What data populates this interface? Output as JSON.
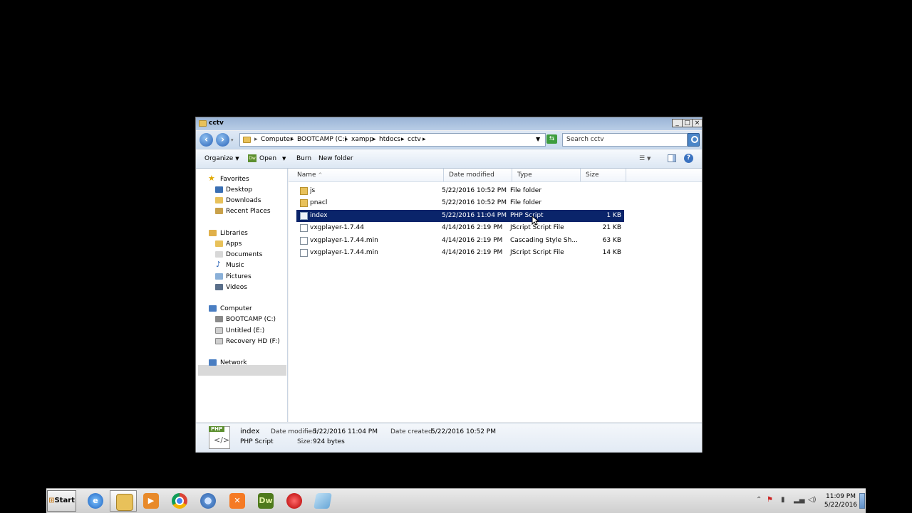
{
  "window": {
    "title": "cctv",
    "caption_buttons": [
      "minimize",
      "maximize",
      "close"
    ]
  },
  "breadcrumb": [
    "Computer",
    "BOOTCAMP (C:)",
    "xampp",
    "htdocs",
    "cctv"
  ],
  "search": {
    "placeholder": "Search cctv"
  },
  "toolbar": {
    "organize": "Organize",
    "open": "Open",
    "burn": "Burn",
    "new_folder": "New folder"
  },
  "nav": {
    "favorites": {
      "label": "Favorites",
      "items": [
        "Desktop",
        "Downloads",
        "Recent Places"
      ]
    },
    "libraries": {
      "label": "Libraries",
      "items": [
        "Apps",
        "Documents",
        "Music",
        "Pictures",
        "Videos"
      ]
    },
    "computer": {
      "label": "Computer",
      "items": [
        "BOOTCAMP (C:)",
        "Untitled (E:)",
        "Recovery HD (F:)"
      ],
      "selected": "BOOTCAMP (C:)"
    },
    "network": {
      "label": "Network"
    }
  },
  "columns": {
    "name": "Name",
    "date": "Date modified",
    "type": "Type",
    "size": "Size"
  },
  "files": [
    {
      "name": "js",
      "date": "5/22/2016 10:52 PM",
      "type": "File folder",
      "size": "",
      "icon": "folder-icon"
    },
    {
      "name": "pnacl",
      "date": "5/22/2016 10:52 PM",
      "type": "File folder",
      "size": "",
      "icon": "folder-icon"
    },
    {
      "name": "index",
      "date": "5/22/2016 11:04 PM",
      "type": "PHP Script",
      "size": "1 KB",
      "icon": "php-file-icon",
      "selected": true
    },
    {
      "name": "vxgplayer-1.7.44",
      "date": "4/14/2016 2:19 PM",
      "type": "JScript Script File",
      "size": "21 KB",
      "icon": "script-file-icon"
    },
    {
      "name": "vxgplayer-1.7.44.min",
      "date": "4/14/2016 2:19 PM",
      "type": "Cascading Style Sh...",
      "size": "63 KB",
      "icon": "css-file-icon"
    },
    {
      "name": "vxgplayer-1.7.44.min",
      "date": "4/14/2016 2:19 PM",
      "type": "JScript Script File",
      "size": "14 KB",
      "icon": "script-file-icon"
    }
  ],
  "details": {
    "icon_label": "PHP",
    "name": "index",
    "type": "PHP Script",
    "date_modified_label": "Date modified:",
    "date_modified": "5/22/2016 11:04 PM",
    "date_created_label": "Date created:",
    "date_created": "5/22/2016 10:52 PM",
    "size_label": "Size:",
    "size": "924 bytes"
  },
  "taskbar": {
    "start": "Start",
    "apps": [
      "internet-explorer-icon",
      "explorer-icon",
      "media-player-icon",
      "chrome-icon",
      "chromium-icon",
      "xampp-icon",
      "dreamweaver-icon",
      "record-icon",
      "notes-icon"
    ],
    "dreamweaver_label": "Dw",
    "clock_time": "11:09 PM",
    "clock_date": "5/22/2016"
  }
}
